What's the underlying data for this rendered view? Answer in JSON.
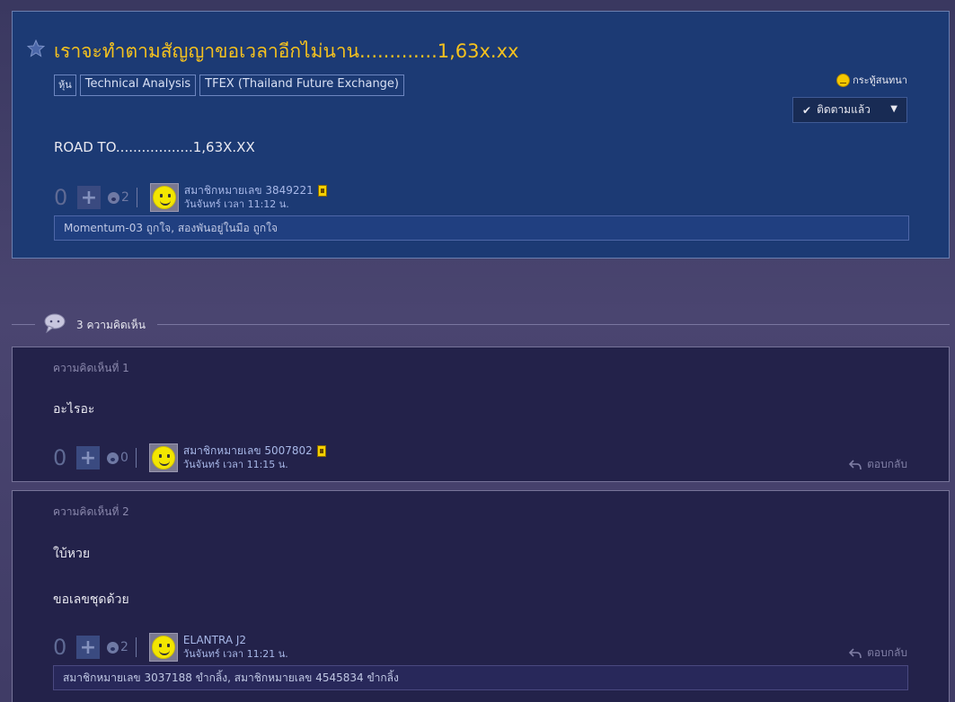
{
  "topic": {
    "title": "เราจะทำตามสัญญาขอเวลาอีกไม่นาน.............1,63x.xx",
    "tags": [
      "หุ้น",
      "Technical Analysis",
      "TFEX (Thailand Future Exchange)"
    ],
    "room_label": "กระทู้สนทนา",
    "follow_label": "ติดตามแล้ว",
    "body": "ROAD TO..................1,63X.XX",
    "votes": "0",
    "emotions": "2",
    "author": "สมาชิกหมายเลข 3849221",
    "time": "วันจันทร์ เวลา 11:12 น.",
    "likers": "Momentum-03 ถูกใจ, สองพันอยู่ในมือ ถูกใจ"
  },
  "comments_header": {
    "count_label": "3 ความคิดเห็น"
  },
  "comments": [
    {
      "label": "ความคิดเห็นที่ 1",
      "text": "อะไรอะ",
      "votes": "0",
      "emotions": "0",
      "author": "สมาชิกหมายเลข 5007802",
      "time": "วันจันทร์ เวลา 11:15 น.",
      "reply_label": "ตอบกลับ"
    },
    {
      "label": "ความคิดเห็นที่ 2",
      "text": "ใบ้หวย",
      "text2": "ขอเลขชุดด้วย",
      "votes": "0",
      "emotions": "2",
      "author": "ELANTRA J2",
      "time": "วันจันทร์ เวลา 11:21 น.",
      "reply_label": "ตอบกลับ",
      "likers": "สมาชิกหมายเลข 3037188 ขำกลิ้ง, สมาชิกหมายเลข 4545834 ขำกลิ้ง"
    }
  ],
  "colors": {
    "title": "#f6c21e",
    "topic_bg": "#1c3a74",
    "comment_bg": "#23224a",
    "page_bg": "#403c66"
  }
}
